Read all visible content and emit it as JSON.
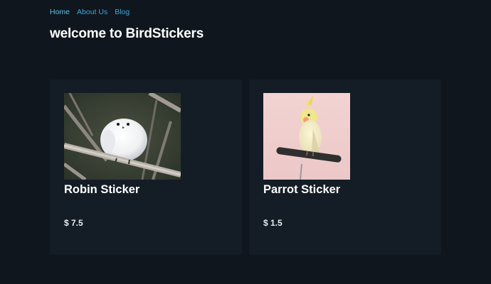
{
  "nav": {
    "items": [
      {
        "label": "Home"
      },
      {
        "label": "About Us"
      },
      {
        "label": "Blog"
      }
    ]
  },
  "header": {
    "title": "welcome to BirdStickers"
  },
  "products": [
    {
      "name": "Robin Sticker",
      "price": "$ 7.5",
      "image_subject": "white fluffy bird on branch"
    },
    {
      "name": "Parrot Sticker",
      "price": "$ 1.5",
      "image_subject": "yellow cockatiel on perch"
    }
  ],
  "colors": {
    "background": "#0f161d",
    "card": "#141d26",
    "link": "#3ea6d8",
    "text": "#ffffff"
  }
}
